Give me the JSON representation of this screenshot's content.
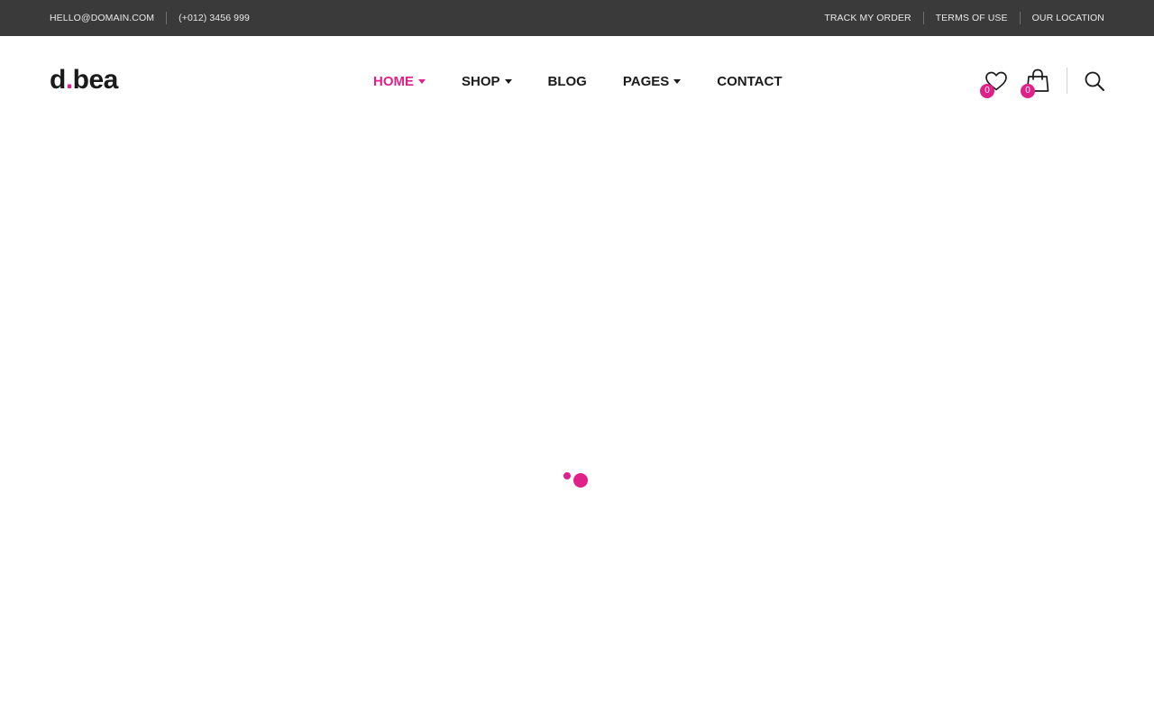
{
  "topbar": {
    "email": "HELLO@DOMAIN.COM",
    "phone": "(+012) 3456 999",
    "links": [
      "TRACK MY ORDER",
      "TERMS OF USE",
      "OUR LOCATION"
    ]
  },
  "header": {
    "logo_left": "d",
    "logo_dot": ".",
    "logo_right": "bea",
    "nav": [
      {
        "label": "HOME",
        "dropdown": true,
        "active": true
      },
      {
        "label": "SHOP",
        "dropdown": true,
        "active": false
      },
      {
        "label": "BLOG",
        "dropdown": false,
        "active": false
      },
      {
        "label": "PAGES",
        "dropdown": true,
        "active": false
      },
      {
        "label": "CONTACT",
        "dropdown": false,
        "active": false
      }
    ],
    "wishlist_count": "0",
    "cart_count": "0",
    "icons": {
      "wishlist": "heart-icon",
      "cart": "shopping-bag-icon",
      "search": "search-icon"
    }
  },
  "loader": {
    "icon": "loading-dots-icon"
  },
  "colors": {
    "accent": "#e0218a",
    "topbar_bg": "#3a3a3a",
    "text": "#1b1b1b"
  }
}
